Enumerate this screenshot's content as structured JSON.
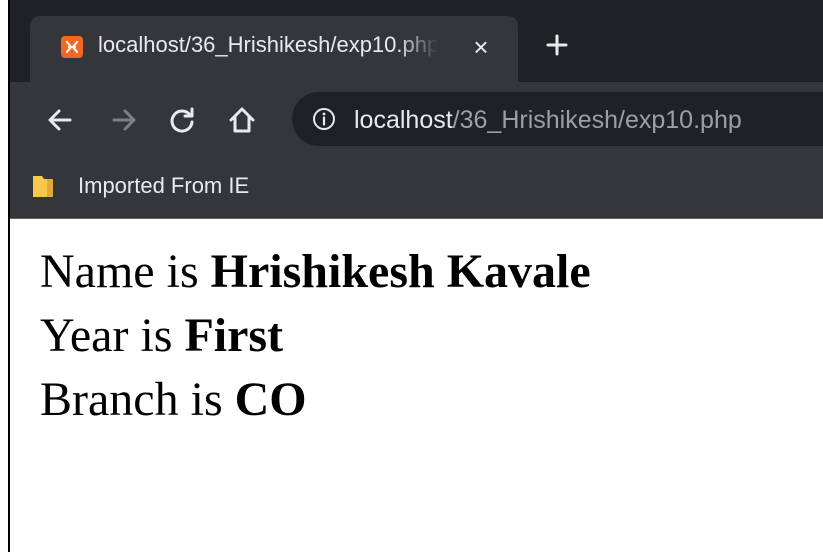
{
  "tab": {
    "title": "localhost/36_Hrishikesh/exp10.php",
    "favicon": "xampp-icon",
    "favicon_color": "#f26822"
  },
  "toolbar": {
    "back_icon": "back-arrow-icon",
    "forward_icon": "forward-arrow-icon",
    "reload_icon": "reload-icon",
    "home_icon": "home-icon"
  },
  "address_bar": {
    "info_icon": "info-icon",
    "host": "localhost",
    "path": "/36_Hrishikesh/exp10.php"
  },
  "bookmarks": [
    {
      "label": "Imported From IE",
      "icon": "folder-icon",
      "icon_color": "#f8c84a"
    }
  ],
  "page": {
    "lines": [
      {
        "prefix": "Name is ",
        "value": "Hrishikesh Kavale"
      },
      {
        "prefix": "Year is ",
        "value": "First"
      },
      {
        "prefix": "Branch is ",
        "value": "CO"
      }
    ]
  },
  "theme": {
    "chrome_dark": "#202124",
    "chrome_toolbar": "#35363a",
    "chrome_text": "#e8eaed",
    "chrome_text_muted": "#9aa0a6"
  }
}
